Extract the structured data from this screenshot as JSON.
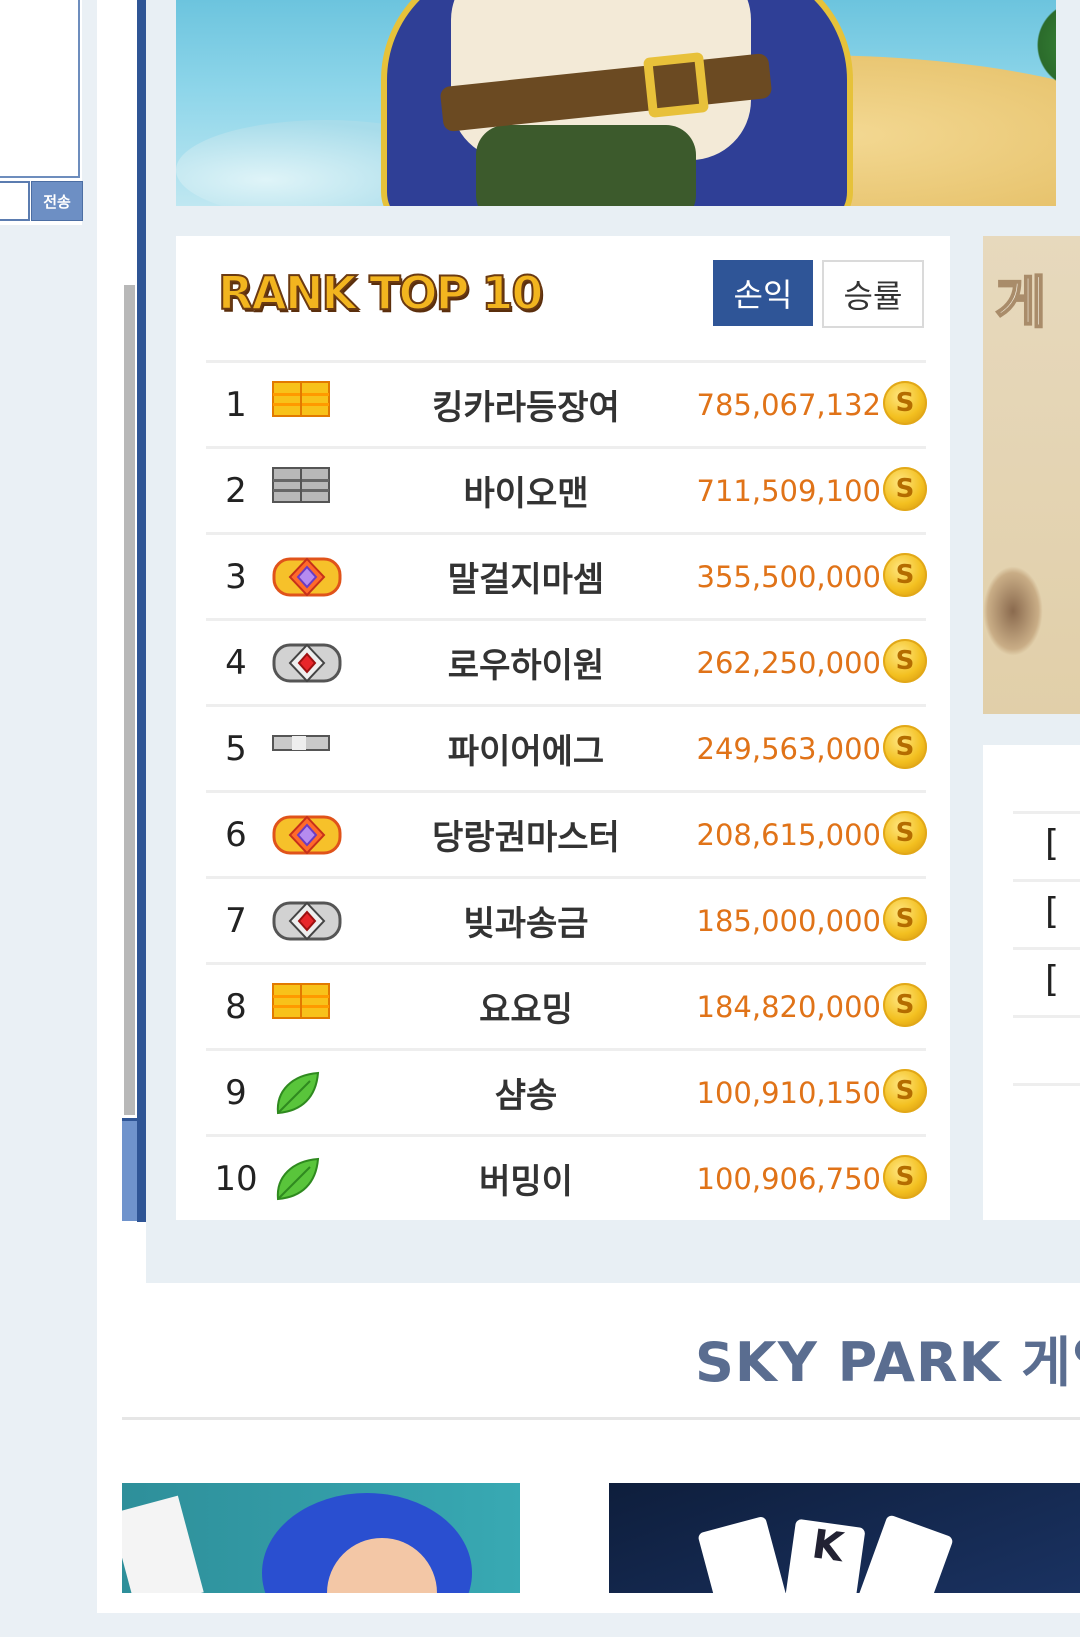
{
  "chat": {
    "send_label": "전송"
  },
  "rank": {
    "title": "RANK TOP 10",
    "tab_profit": "손익",
    "tab_winrate": "승률",
    "coin_glyph": "S",
    "rows": [
      {
        "rank": "1",
        "badge": "gold-bar",
        "name": "킹카라등장여",
        "amount": "785,067,132"
      },
      {
        "rank": "2",
        "badge": "silver-bar",
        "name": "바이오맨",
        "amount": "711,509,100"
      },
      {
        "rank": "3",
        "badge": "gold-ring",
        "name": "말걸지마셈",
        "amount": "355,500,000"
      },
      {
        "rank": "4",
        "badge": "silver-ring",
        "name": "로우하이원",
        "amount": "262,250,000"
      },
      {
        "rank": "5",
        "badge": "thin-bar",
        "name": "파이어에그",
        "amount": "249,563,000"
      },
      {
        "rank": "6",
        "badge": "gold-ring",
        "name": "당랑권마스터",
        "amount": "208,615,000"
      },
      {
        "rank": "7",
        "badge": "silver-ring",
        "name": "빚과송금",
        "amount": "185,000,000"
      },
      {
        "rank": "8",
        "badge": "gold-bar",
        "name": "요요밍",
        "amount": "184,820,000"
      },
      {
        "rank": "9",
        "badge": "leaf",
        "name": "샴송",
        "amount": "100,910,150"
      },
      {
        "rank": "10",
        "badge": "leaf",
        "name": "버밍이",
        "amount": "100,906,750"
      }
    ]
  },
  "side": {
    "banner_text": "게",
    "brackets": [
      "[",
      "[",
      "["
    ]
  },
  "games": {
    "section_title": "SKY PARK 게임"
  },
  "colors": {
    "accent": "#2f5597",
    "amount": "#e07318"
  }
}
